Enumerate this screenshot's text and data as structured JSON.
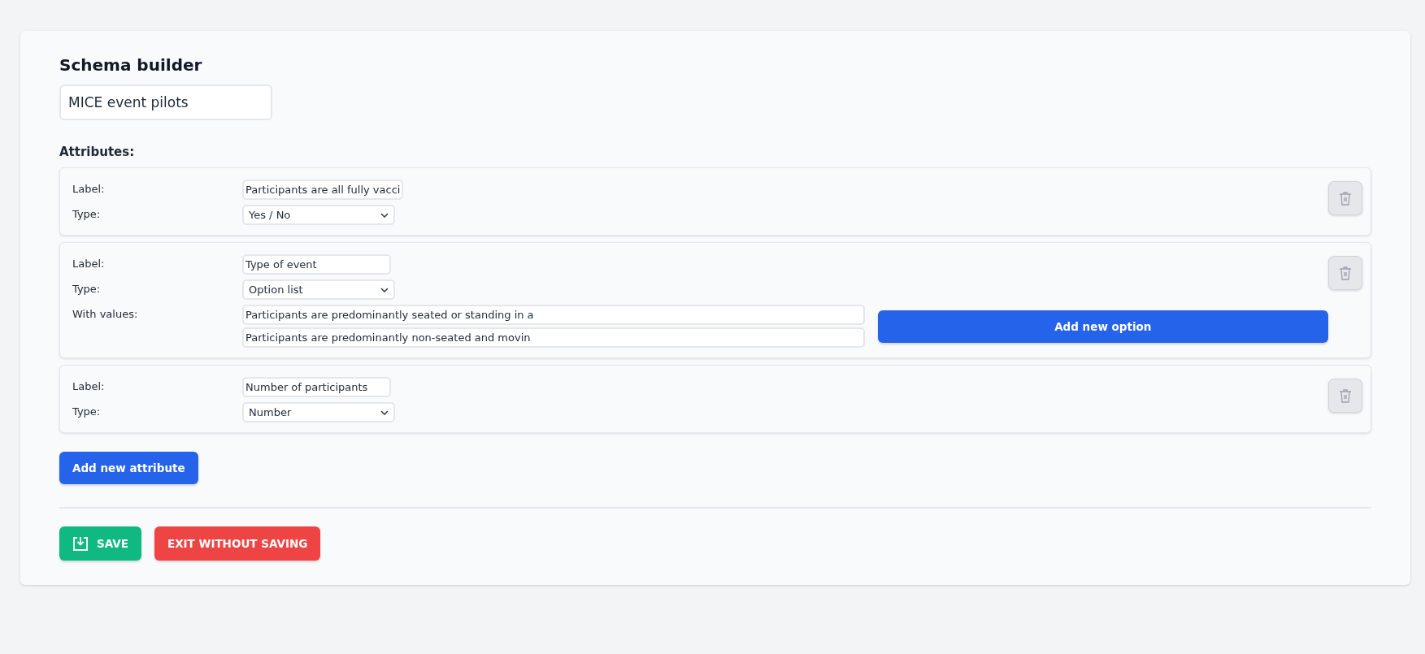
{
  "title": "Schema builder",
  "schema_name": {
    "value": "MICE event pilots"
  },
  "attributes_heading": "Attributes:",
  "attributes": [
    {
      "label_caption": "Label:",
      "label_value": "Participants are all fully vacci",
      "type_caption": "Type:",
      "type_value": "Yes / No"
    },
    {
      "label_caption": "Label:",
      "label_value": "Type of event",
      "type_caption": "Type:",
      "type_value": "Option list",
      "values_caption": "With values:",
      "values": [
        "Participants are predominantly seated or standing in a",
        "Participants are predominantly non-seated and movin"
      ],
      "add_option": "Add new option"
    },
    {
      "label_caption": "Label:",
      "label_value": "Number of participants",
      "type_caption": "Type:",
      "type_value": "Number"
    }
  ],
  "add_attribute": "Add new attribute",
  "actions": [
    {
      "kind": "save",
      "label": "SAVE"
    },
    {
      "kind": "exit",
      "label": "EXIT WITHOUT SAVING"
    }
  ]
}
